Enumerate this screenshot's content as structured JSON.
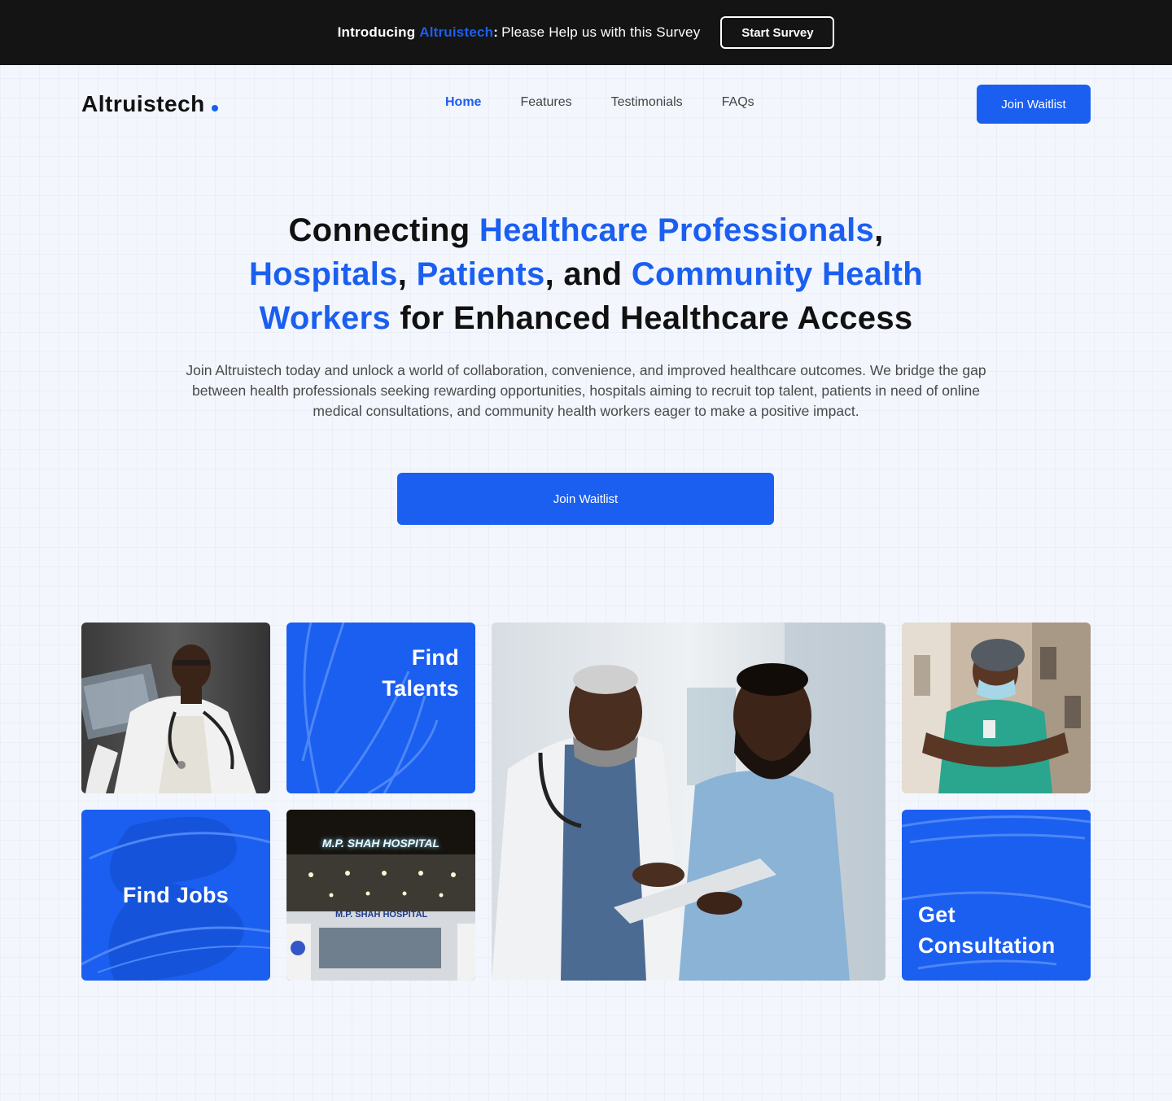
{
  "announcement": {
    "intro": "Introducing",
    "brand": "Altruistech",
    "colon": ":",
    "message": "Please Help us with this Survey",
    "button_label": "Start Survey"
  },
  "navbar": {
    "logo": "Altruistech",
    "links": [
      "Home",
      "Features",
      "Testimonials",
      "FAQs"
    ],
    "active_link": "Home",
    "cta_label": "Join Waitlist"
  },
  "hero": {
    "title": {
      "part1": "Connecting ",
      "hl1": "Healthcare Professionals",
      "part2": ",",
      "hl2": "Hospitals",
      "part3": ", ",
      "hl3": "Patients",
      "part4": ", and ",
      "hl4": "Community Health Workers",
      "part5": " for Enhanced Healthcare Access"
    },
    "subtitle": "Join Altruistech today and unlock a world of collaboration, convenience, and improved healthcare outcomes. We bridge the gap between health professionals seeking rewarding opportunities, hospitals aiming to recruit top talent, patients in need of online medical consultations, and community health workers eager to make a positive impact.",
    "cta_label": "Join Waitlist"
  },
  "tiles": {
    "find_talents": "Find Talents",
    "find_jobs": "Find Jobs",
    "get_consultation": "Get Consultation",
    "hospital_sign_top": "M.P. SHAH HOSPITAL",
    "hospital_sign_front": "M.P. SHAH HOSPITAL"
  },
  "colors": {
    "accent": "#1b5ff0",
    "announcement_bg": "#141414",
    "page_bg": "#f3f6fd"
  }
}
